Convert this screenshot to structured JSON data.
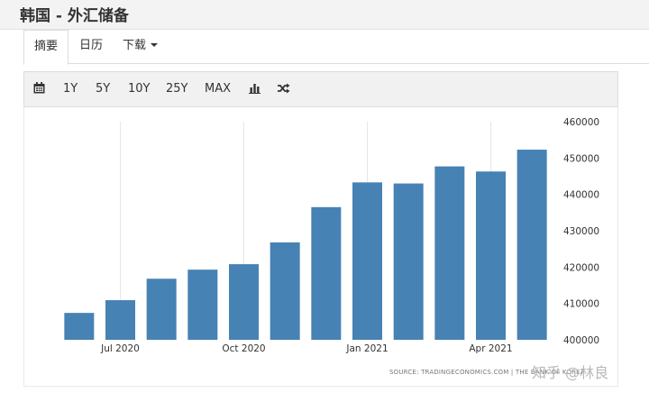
{
  "header": {
    "title": "韩国 - 外汇储备"
  },
  "tabs": [
    {
      "label": "摘要"
    },
    {
      "label": "日历"
    },
    {
      "label": "下载"
    }
  ],
  "toolbar": {
    "ranges": [
      "1Y",
      "5Y",
      "10Y",
      "25Y",
      "MAX"
    ],
    "icons": [
      "calendar-icon",
      "bar-chart-icon",
      "shuffle-icon"
    ]
  },
  "chart_data": {
    "type": "bar",
    "title": "",
    "xlabel": "",
    "ylabel": "",
    "x_ticks": [
      "Jul 2020",
      "Oct 2020",
      "Jan 2021",
      "Apr 2021"
    ],
    "y_ticks": [
      "400000",
      "410000",
      "420000",
      "430000",
      "440000",
      "450000",
      "460000"
    ],
    "ylim": [
      400000,
      460000
    ],
    "categories": [
      "2020-05",
      "2020-06",
      "2020-07",
      "2020-08",
      "2020-09",
      "2020-10",
      "2020-11",
      "2020-12",
      "2021-01",
      "2021-02",
      "2021-03",
      "2021-04"
    ],
    "values": [
      407400,
      410900,
      416800,
      419300,
      420800,
      426800,
      436500,
      443300,
      443000,
      447700,
      446300,
      452300
    ],
    "bar_color": "#4682b4",
    "grid": true
  },
  "footer": {
    "source": "SOURCE: TRADINGECONOMICS.COM | THE BANK OF KOREA",
    "watermark": "知乎 @林良"
  }
}
